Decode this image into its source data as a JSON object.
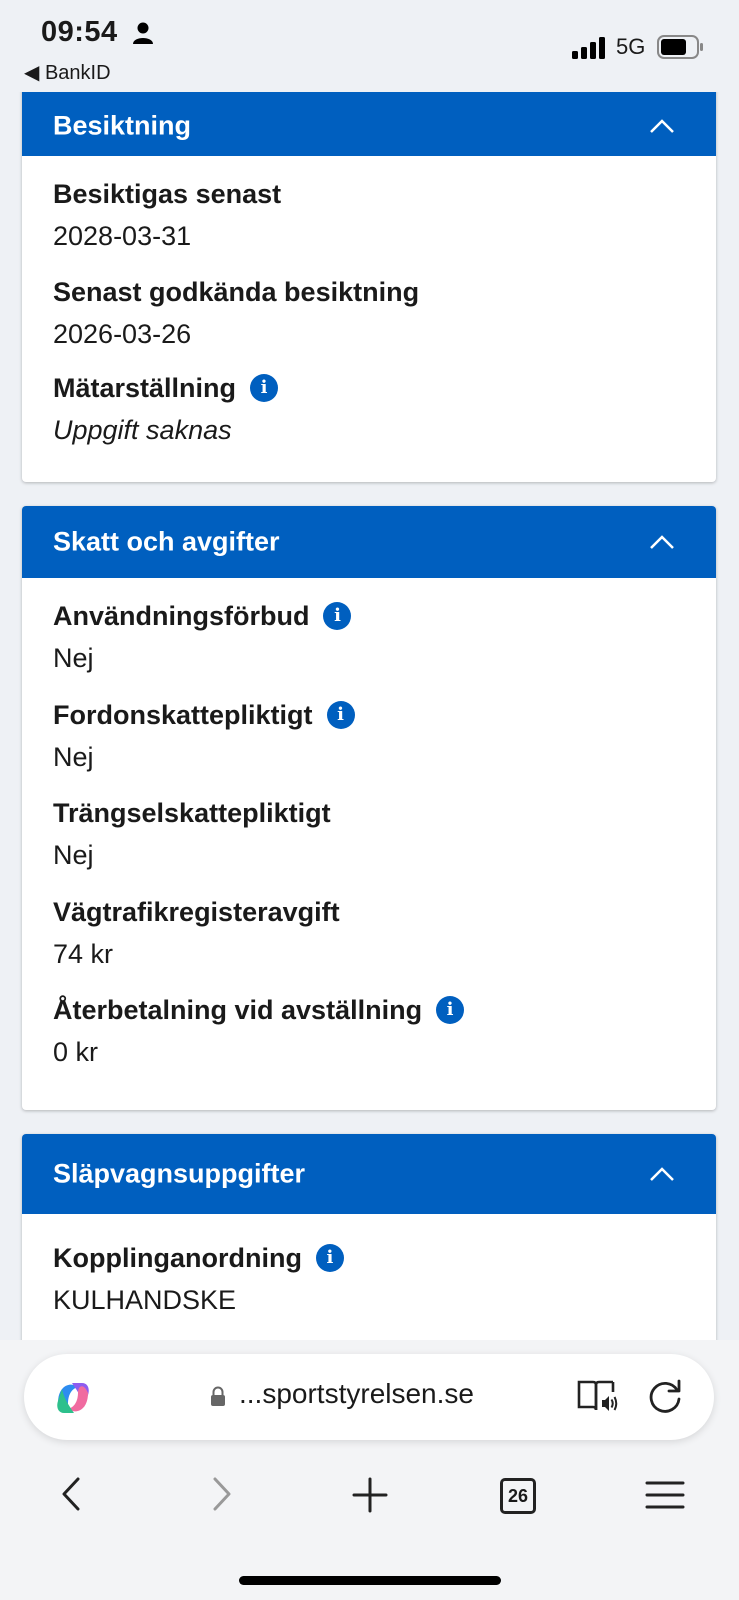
{
  "status_bar": {
    "time": "09:54",
    "back_app": "BankID",
    "network": "5G"
  },
  "sections": [
    {
      "title": "Besiktning",
      "fields": [
        {
          "label": "Besiktigas senast",
          "value": "2028-03-31"
        },
        {
          "label": "Senast godkända besiktning",
          "value": "2026-03-26"
        },
        {
          "label": "Mätarställning",
          "value": "Uppgift saknas"
        }
      ]
    },
    {
      "title": "Skatt och avgifter",
      "fields": [
        {
          "label": "Användningsförbud",
          "value": "Nej"
        },
        {
          "label": "Fordonskattepliktigt",
          "value": "Nej"
        },
        {
          "label": "Trängselskattepliktigt",
          "value": "Nej"
        },
        {
          "label": "Vägtrafikregisteravgift",
          "value": "74 kr"
        },
        {
          "label": "Återbetalning vid avställning",
          "value": "0 kr"
        }
      ]
    },
    {
      "title": "Släpvagnsuppgifter",
      "fields": [
        {
          "label": "Kopplinganordning",
          "value": "KULHANDSKE"
        }
      ]
    }
  ],
  "browser": {
    "url": "...sportstyrelsen.se",
    "tab_count": "26"
  },
  "colors": {
    "accent": "#005fbf",
    "background": "#eef1f5"
  }
}
